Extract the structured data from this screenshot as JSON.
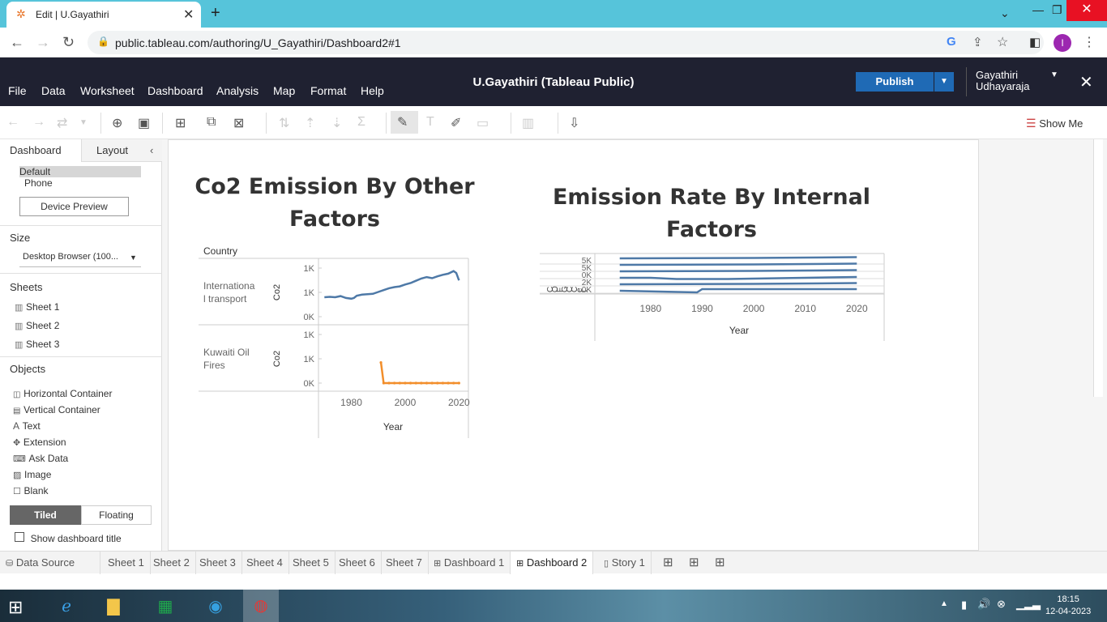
{
  "browser": {
    "tab_title": "Edit | U.Gayathiri",
    "url": "public.tableau.com/authoring/U_Gayathiri/Dashboard2#1",
    "avatar_letter": "I"
  },
  "tableau": {
    "menus": [
      "File",
      "Data",
      "Worksheet",
      "Dashboard",
      "Analysis",
      "Map",
      "Format",
      "Help"
    ],
    "title": "U.Gayathiri (Tableau Public)",
    "publish_label": "Publish",
    "user_name_line1": "Gayathiri",
    "user_name_line2": "Udhayaraja",
    "show_me": "Show Me"
  },
  "left_panel": {
    "tab_dashboard": "Dashboard",
    "tab_layout": "Layout",
    "device_default": "Default",
    "device_phone": "Phone",
    "device_preview": "Device Preview",
    "size_heading": "Size",
    "size_value": "Desktop Browser (100...",
    "sheets_heading": "Sheets",
    "sheets": [
      "Sheet 1",
      "Sheet 2",
      "Sheet 3"
    ],
    "objects_heading": "Objects",
    "objects": [
      "Horizontal Container",
      "Vertical Container",
      "Text",
      "Extension",
      "Ask Data",
      "Image",
      "Blank"
    ],
    "tiled": "Tiled",
    "floating": "Floating",
    "show_title": "Show dashboard title"
  },
  "dashboard": {
    "title_left_line1": "Co2 Emission By Other",
    "title_left_line2": "Factors",
    "title_right_line1": "Emission Rate By Internal",
    "title_right_line2": "Factors"
  },
  "chart_data": [
    {
      "type": "line",
      "row_header": "Country",
      "ylabel": "Co2",
      "xlabel": "Year",
      "x_ticks": [
        "1980",
        "2000",
        "2020"
      ],
      "xlim": [
        1969,
        2022
      ],
      "panels": [
        {
          "name": "International transport",
          "label_line1": "Internationa",
          "label_line2": "l transport",
          "y_ticks": [
            "1K",
            "1K",
            "0K"
          ],
          "ylim": [
            0,
            1.3
          ],
          "color": "#4e79a7",
          "x": [
            1970,
            1972,
            1974,
            1976,
            1978,
            1980,
            1981,
            1982,
            1984,
            1986,
            1988,
            1990,
            1992,
            1994,
            1996,
            1998,
            2000,
            2002,
            2004,
            2006,
            2008,
            2010,
            2012,
            2014,
            2016,
            2018,
            2019,
            2020
          ],
          "values": [
            0.52,
            0.53,
            0.52,
            0.55,
            0.5,
            0.48,
            0.5,
            0.56,
            0.59,
            0.6,
            0.61,
            0.66,
            0.71,
            0.76,
            0.79,
            0.81,
            0.86,
            0.9,
            0.96,
            1.02,
            1.06,
            1.03,
            1.08,
            1.12,
            1.15,
            1.22,
            1.17,
            0.97
          ]
        },
        {
          "name": "Kuwaiti Oil Fires",
          "label_line1": "Kuwaiti Oil",
          "label_line2": "Fires",
          "y_ticks": [
            "1K",
            "1K",
            "0K"
          ],
          "ylim": [
            0,
            1.3
          ],
          "color": "#f28e2b",
          "x": [
            1991,
            1992,
            1994,
            1996,
            1998,
            2000,
            2002,
            2004,
            2006,
            2008,
            2010,
            2012,
            2014,
            2016,
            2018,
            2020
          ],
          "values": [
            0.55,
            0,
            0,
            0,
            0,
            0,
            0,
            0,
            0,
            0,
            0,
            0,
            0,
            0,
            0,
            0
          ]
        }
      ]
    },
    {
      "type": "line",
      "xlabel": "Year",
      "x_ticks": [
        "1980",
        "1990",
        "2000",
        "2010",
        "2020"
      ],
      "xlim": [
        1972,
        2022
      ],
      "row_labels": [
        "C",
        "O",
        "F",
        "G",
        "C",
        "C",
        "e",
        "t"
      ],
      "y_ticks": [
        "5K",
        "5K",
        "0K",
        "2K",
        "0K"
      ],
      "color": "#4e79a7",
      "series_count": 6
    }
  ],
  "sheet_tabs": [
    "Data Source",
    "Sheet 1",
    "Sheet 2",
    "Sheet 3",
    "Sheet 4",
    "Sheet 5",
    "Sheet 6",
    "Sheet 7",
    "Dashboard 1",
    "Dashboard 2",
    "Story 1"
  ],
  "taskbar": {
    "time": "18:15",
    "date": "12-04-2023"
  }
}
